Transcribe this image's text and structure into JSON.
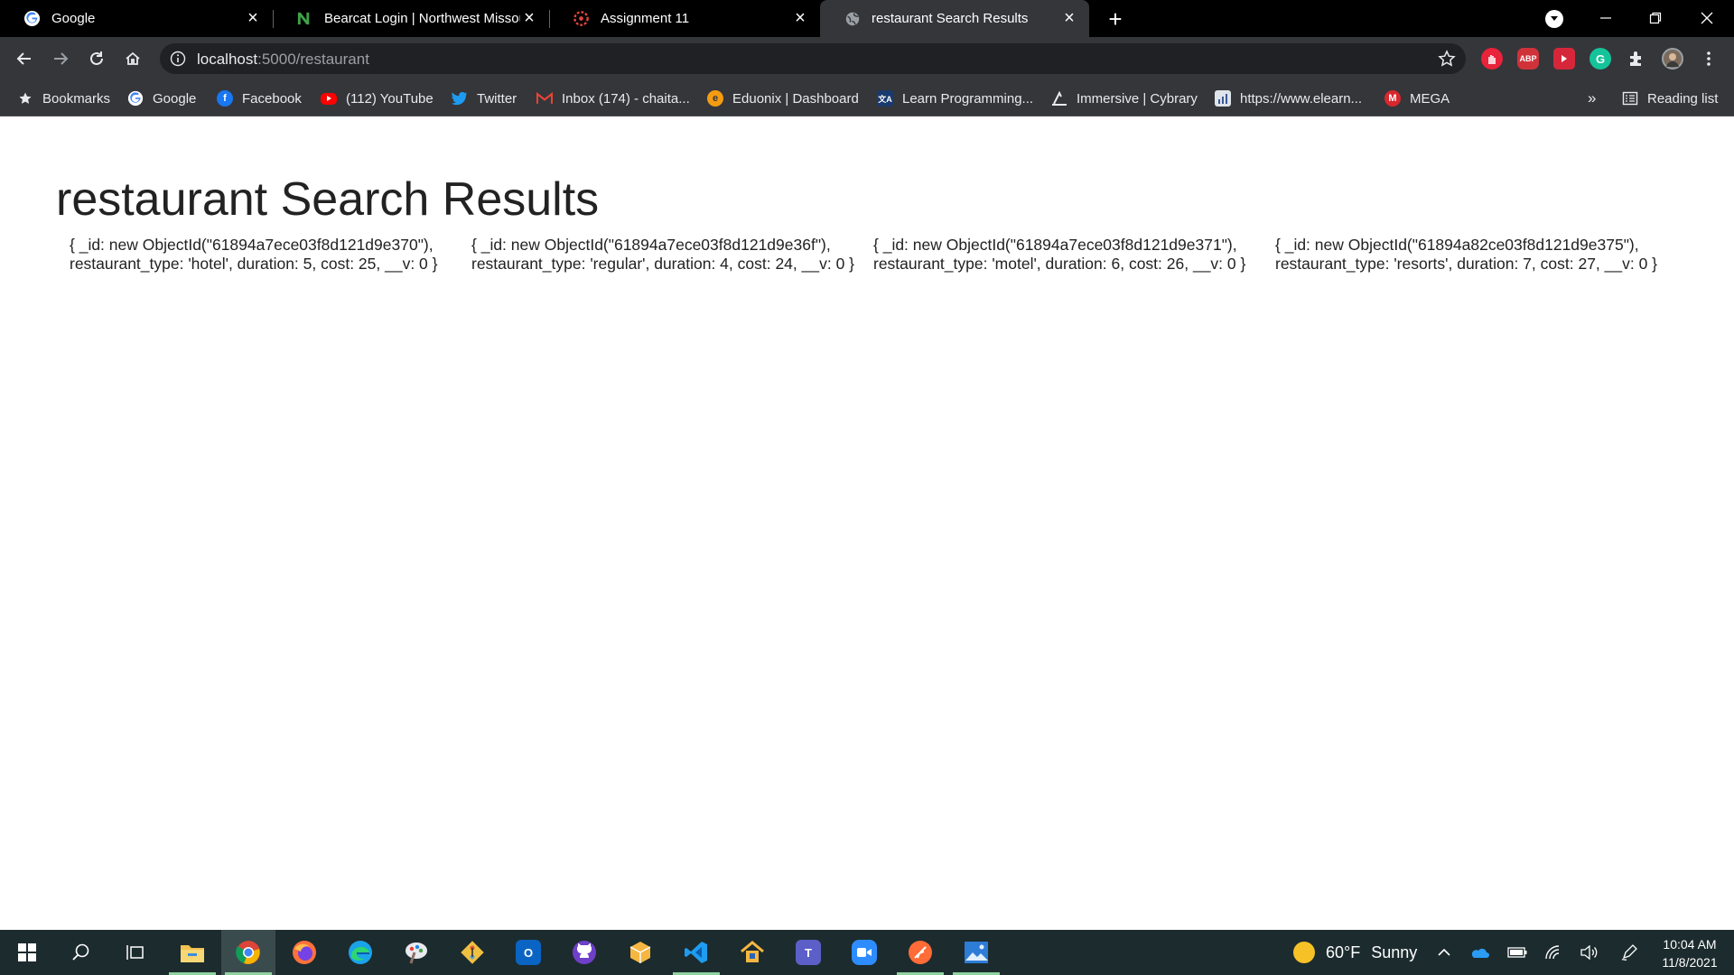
{
  "browser": {
    "tabs": [
      {
        "title": "Google",
        "icon": "google-icon",
        "active": false
      },
      {
        "title": "Bearcat Login | Northwest Missou",
        "icon": "northwest-icon",
        "active": false
      },
      {
        "title": "Assignment 11",
        "icon": "assignment-icon",
        "active": false
      },
      {
        "title": "restaurant Search Results",
        "icon": "globe-icon",
        "active": true
      }
    ],
    "new_tab_label": "+",
    "url_host": "localhost",
    "url_path": ":5000/restaurant"
  },
  "bookmarks": {
    "items": [
      {
        "label": "Bookmarks",
        "icon": "star-icon"
      },
      {
        "label": "Google",
        "icon": "google-icon"
      },
      {
        "label": "Facebook",
        "icon": "facebook-icon"
      },
      {
        "label": "(112) YouTube",
        "icon": "youtube-icon"
      },
      {
        "label": "Twitter",
        "icon": "twitter-icon"
      },
      {
        "label": "Inbox (174) - chaita...",
        "icon": "gmail-icon"
      },
      {
        "label": "Eduonix | Dashboard",
        "icon": "eduonix-icon"
      },
      {
        "label": "Learn Programming...",
        "icon": "learn-icon"
      },
      {
        "label": "Immersive | Cybrary",
        "icon": "cybrary-icon"
      },
      {
        "label": "https://www.elearn...",
        "icon": "elearn-icon"
      },
      {
        "label": "MEGA",
        "icon": "mega-icon"
      }
    ],
    "overflow_label": "»",
    "reading_list_label": "Reading list"
  },
  "page": {
    "title": "restaurant Search Results",
    "results": [
      "{ _id: new ObjectId(\"61894a7ece03f8d121d9e370\"), restaurant_type: 'hotel', duration: 5, cost: 25, __v: 0 }",
      "{ _id: new ObjectId(\"61894a7ece03f8d121d9e36f\"), restaurant_type: 'regular', duration: 4, cost: 24, __v: 0 }",
      "{ _id: new ObjectId(\"61894a7ece03f8d121d9e371\"), restaurant_type: 'motel', duration: 6, cost: 26, __v: 0 }",
      "{ _id: new ObjectId(\"61894a82ce03f8d121d9e375\"), restaurant_type: 'resorts', duration: 7, cost: 27, __v: 0 }"
    ]
  },
  "extensions": {
    "abp_label": "ABP",
    "grammarly_label": "G"
  },
  "taskbar": {
    "weather_temp": "60°F",
    "weather_cond": "Sunny",
    "time": "10:04 AM",
    "date": "11/8/2021"
  },
  "colors": {
    "tab_strip": "#000000",
    "toolbar": "#35363a",
    "omnibox": "#202124",
    "taskbar": "#1c2b2e"
  }
}
